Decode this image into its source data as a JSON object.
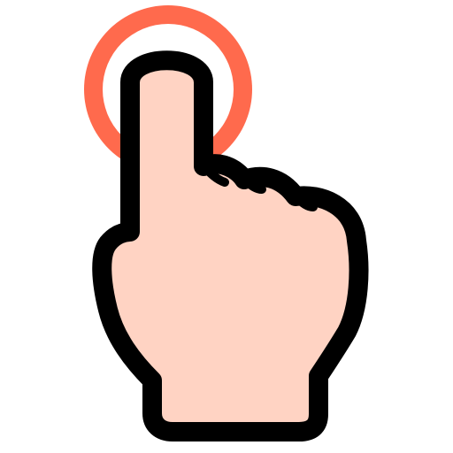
{
  "icon": {
    "name": "tap-gesture-icon",
    "parts": [
      "tap-ring-icon",
      "pointing-hand-icon"
    ]
  },
  "colors": {
    "background": "#ffffff",
    "ring": "#ff6a4d",
    "ring_inner": "#ffffff",
    "skin": "#ffd3c3",
    "outline": "#000000"
  }
}
